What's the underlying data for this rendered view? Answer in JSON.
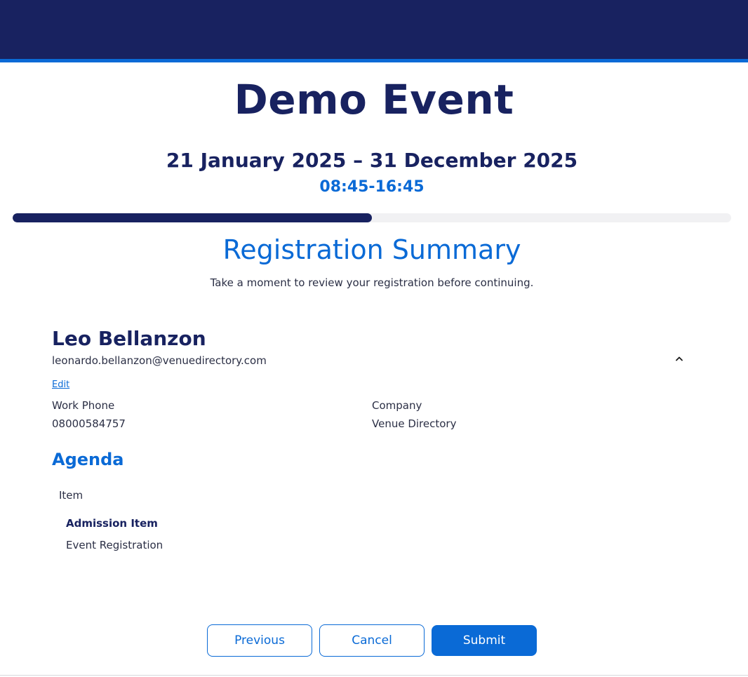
{
  "event": {
    "title": "Demo Event",
    "dates": "21 January 2025 – 31 December 2025",
    "time": "08:45-16:45"
  },
  "progress": {
    "fraction": 0.5
  },
  "summary": {
    "title": "Registration Summary",
    "subtitle": "Take a moment to review your registration before continuing."
  },
  "attendee": {
    "name": "Leo Bellanzon",
    "email": "leonardo.bellanzon@venuedirectory.com",
    "edit_label": "Edit",
    "fields": [
      {
        "label": "Work Phone",
        "value": "08000584757"
      },
      {
        "label": "Company",
        "value": "Venue Directory"
      }
    ]
  },
  "agenda": {
    "title": "Agenda",
    "column_header": "Item",
    "items": [
      {
        "name": "Admission Item",
        "description": "Event Registration"
      }
    ]
  },
  "actions": {
    "previous_label": "Previous",
    "cancel_label": "Cancel",
    "submit_label": "Submit"
  },
  "colors": {
    "banner": "#182260",
    "accent": "#0a6ad6"
  },
  "icons": {
    "collapse": "chevron-up-icon"
  }
}
